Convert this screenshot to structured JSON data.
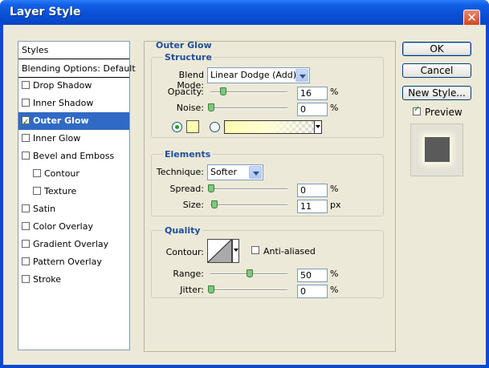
{
  "window": {
    "title": "Layer Style",
    "close_glyph": "✕"
  },
  "styles_list": {
    "header": "Styles",
    "blending": "Blending Options: Default",
    "items": [
      {
        "label": "Drop Shadow",
        "checked": false,
        "indent": false,
        "selected": false
      },
      {
        "label": "Inner Shadow",
        "checked": false,
        "indent": false,
        "selected": false
      },
      {
        "label": "Outer Glow",
        "checked": true,
        "indent": false,
        "selected": true
      },
      {
        "label": "Inner Glow",
        "checked": false,
        "indent": false,
        "selected": false
      },
      {
        "label": "Bevel and Emboss",
        "checked": false,
        "indent": false,
        "selected": false
      },
      {
        "label": "Contour",
        "checked": false,
        "indent": true,
        "selected": false
      },
      {
        "label": "Texture",
        "checked": false,
        "indent": true,
        "selected": false
      },
      {
        "label": "Satin",
        "checked": false,
        "indent": false,
        "selected": false
      },
      {
        "label": "Color Overlay",
        "checked": false,
        "indent": false,
        "selected": false
      },
      {
        "label": "Gradient Overlay",
        "checked": false,
        "indent": false,
        "selected": false
      },
      {
        "label": "Pattern Overlay",
        "checked": false,
        "indent": false,
        "selected": false
      },
      {
        "label": "Stroke",
        "checked": false,
        "indent": false,
        "selected": false
      }
    ]
  },
  "panel": {
    "title": "Outer Glow",
    "structure": {
      "title": "Structure",
      "blend_mode_label": "Blend Mode:",
      "blend_mode_value": "Linear Dodge (Add)",
      "opacity_label": "Opacity:",
      "opacity_value": "16",
      "opacity_unit": "%",
      "opacity_level": 0.16,
      "noise_label": "Noise:",
      "noise_value": "0",
      "noise_unit": "%",
      "noise_level": 0.0,
      "glow_color": "#fffbb0"
    },
    "elements": {
      "title": "Elements",
      "technique_label": "Technique:",
      "technique_value": "Softer",
      "spread_label": "Spread:",
      "spread_value": "0",
      "spread_unit": "%",
      "spread_level": 0.0,
      "size_label": "Size:",
      "size_value": "11",
      "size_unit": "px",
      "size_level": 0.04
    },
    "quality": {
      "title": "Quality",
      "contour_label": "Contour:",
      "antialiased_label": "Anti-aliased",
      "antialiased_checked": false,
      "range_label": "Range:",
      "range_value": "50",
      "range_unit": "%",
      "range_level": 0.5,
      "jitter_label": "Jitter:",
      "jitter_value": "0",
      "jitter_unit": "%",
      "jitter_level": 0.0
    }
  },
  "buttons": {
    "ok": "OK",
    "cancel": "Cancel",
    "new_style": "New Style...",
    "preview_label": "Preview",
    "preview_checked": true
  },
  "colors": {
    "selection": "#316ac5",
    "group_title": "#1f4f9c",
    "dialog_bg": "#ece9d8",
    "preview_square": "#5a5a5a"
  }
}
